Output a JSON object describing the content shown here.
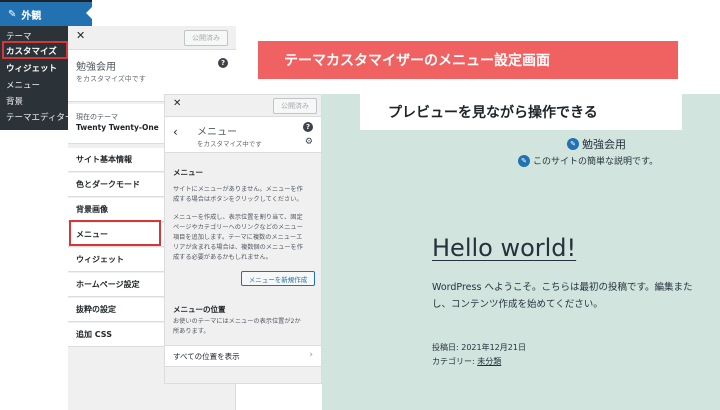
{
  "wp_menu": {
    "appearance_label": "外観",
    "items": [
      "テーマ",
      "カスタマイズ",
      "ウィジェット",
      "メニュー",
      "背景",
      "テーマエディター"
    ]
  },
  "panel1": {
    "close": "✕",
    "publish_label": "公開済み",
    "site_name": "勉強会用",
    "customizing": "をカスタマイズ中です",
    "help": "?",
    "current_theme_label": "現在のテーマ",
    "current_theme_name": "Twenty Twenty-One",
    "sections": [
      "サイト基本情報",
      "色とダークモード",
      "背景画像",
      "メニュー",
      "ウィジェット",
      "ホームページ設定",
      "抜粋の設定",
      "追加 CSS"
    ]
  },
  "panel2": {
    "close": "✕",
    "publish_label": "公開済み",
    "back": "‹",
    "title": "メニュー",
    "subtitle": "をカスタマイズ中です",
    "help": "?",
    "gear": "⚙",
    "section_menu": "メニュー",
    "para1": [
      "サイトにメニューがありません。メニューを作",
      "成する場合はボタンをクリックしてください。"
    ],
    "para2": [
      "メニューを作成し、表示位置を割り当て、固定",
      "ページやカテゴリーへのリンクなどのメニュー",
      "項目を追加します。テーマに複数のメニューエ",
      "リアが含まれる場合は、複数個のメニューを作",
      "成する必要があるかもしれません。"
    ],
    "new_menu_button": "メニューを新規作成",
    "section_location": "メニューの位置",
    "para3": [
      "お使いのテーマにはメニューの表示位置が2か",
      "所あります。"
    ],
    "all_locations": "すべての位置を表示",
    "chevron": "›"
  },
  "preview": {
    "site_title": "勉強会用",
    "tagline": "このサイトの簡単な説明です。",
    "post_title": "Hello world!",
    "body_lines": [
      "WordPress へようこそ。こちらは最初の投稿です。編集また",
      "し、コンテンツ作成を始めてください。"
    ],
    "posted_on": "投稿日: 2021年12月21日",
    "category_label": "カテゴリー: ",
    "category": "未分類"
  },
  "banners": {
    "top": "テーマカスタマイザーのメニュー設定画面",
    "preview": "プレビューを見ながら操作できる"
  },
  "colors": {
    "admin_bar": "#1d2327",
    "accent_blue": "#2271b1",
    "highlight_red": "#d63638",
    "banner_red": "#f06262",
    "preview_bg": "#d1e4dd"
  }
}
